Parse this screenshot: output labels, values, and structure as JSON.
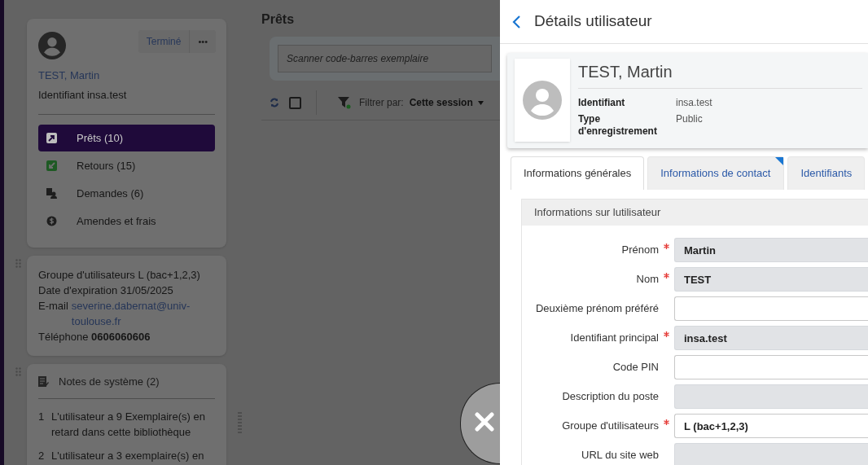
{
  "patron_card": {
    "name": "TEST, Martin",
    "id_line": "Identifiant insa.test",
    "done_button": "Terminé",
    "more_button": "•••",
    "nav": [
      {
        "label": "Prêts (10)",
        "selected": true
      },
      {
        "label": "Retours (15)",
        "selected": false
      },
      {
        "label": "Demandes (6)",
        "selected": false
      },
      {
        "label": "Amendes et frais",
        "selected": false
      }
    ]
  },
  "info_card": {
    "lines": [
      {
        "label": "Groupe d'utilisateurs",
        "value": "L (bac+1,2,3)",
        "kind": "text"
      },
      {
        "label": "Date d'expiration",
        "value": "31/05/2025",
        "kind": "text"
      },
      {
        "label": "E-mail",
        "value": "severine.dabernat@univ-toulouse.fr",
        "kind": "link"
      },
      {
        "label": "Téléphone",
        "value": "0606060606",
        "kind": "bold"
      }
    ]
  },
  "notes_card": {
    "title": "Notes de système (2)",
    "notes": [
      {
        "number": "1",
        "text": "L'utilisateur a 9 Exemplaire(s) en retard dans cette bibliothèque"
      },
      {
        "number": "2",
        "text": "L'utilisateur a 3 exemplaire(s) en"
      }
    ]
  },
  "loans": {
    "title": "Prêts",
    "scan_placeholder": "Scanner code-barres exemplaire",
    "filter_label": "Filtrer par:",
    "filter_value": "Cette session",
    "select_all": {
      "checked": false
    }
  },
  "details": {
    "title": "Détails utilisateur",
    "name": "TEST, Martin",
    "facts": [
      {
        "label": "Identifiant",
        "value": "insa.test"
      },
      {
        "label": "Type d'enregistrement",
        "value": "Public"
      }
    ],
    "tabs": [
      {
        "label": "Informations générales",
        "selected": true,
        "flagged": false
      },
      {
        "label": "Informations de contact",
        "selected": false,
        "flagged": true
      },
      {
        "label": "Identifiants",
        "selected": false,
        "flagged": false
      }
    ],
    "section_title": "Informations sur lutilisateur",
    "fields": [
      {
        "label": "Prénom",
        "required": true,
        "value": "Martin",
        "disabled": true
      },
      {
        "label": "Nom",
        "required": true,
        "value": "TEST",
        "disabled": true
      },
      {
        "label": "Deuxième prénom préféré",
        "required": false,
        "disabled": false
      },
      {
        "label": "Identifiant principal",
        "required": true,
        "value": "insa.test",
        "disabled": true
      },
      {
        "label": "Code PIN",
        "required": false,
        "disabled": false
      },
      {
        "label": "Description du poste",
        "required": false,
        "disabled": true
      },
      {
        "label": "Groupe d'utilisateurs",
        "required": true,
        "value": "L (bac+1,2,3)",
        "disabled": false
      },
      {
        "label": "URL du site web",
        "required": false,
        "disabled": true
      }
    ]
  }
}
